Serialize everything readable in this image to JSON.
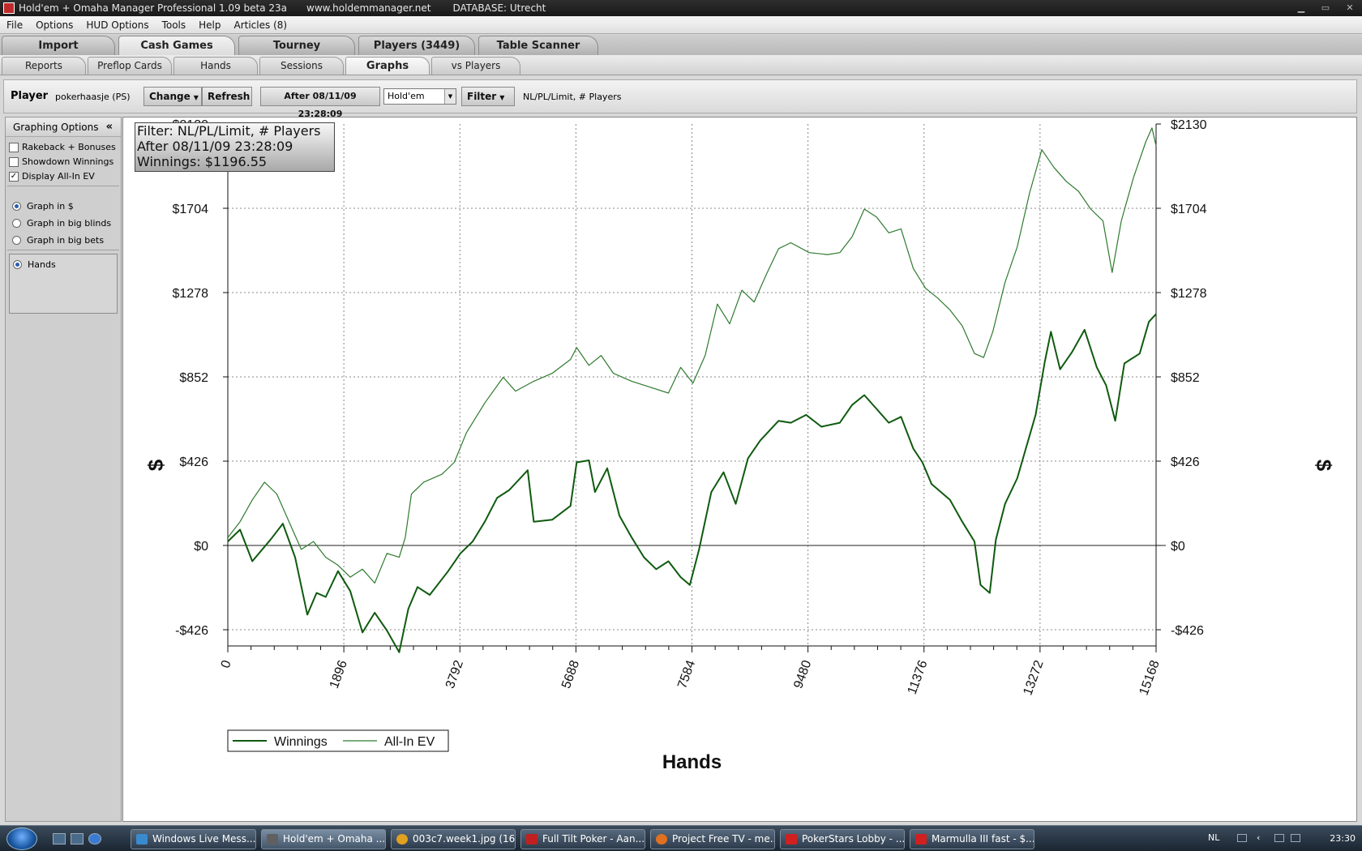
{
  "window": {
    "title": "Hold'em + Omaha Manager Professional 1.09 beta 23a",
    "website": "www.holdemmanager.net",
    "database": "DATABASE: Utrecht",
    "controls": [
      "▁",
      "▭",
      "✕"
    ]
  },
  "menu": [
    "File",
    "Options",
    "HUD Options",
    "Tools",
    "Help",
    "Articles (8)"
  ],
  "main_tabs": [
    "Import",
    "Cash Games",
    "Tourney",
    "Players (3449)",
    "Table Scanner"
  ],
  "main_tab_active": "Cash Games",
  "sub_tabs": [
    "Reports",
    "Preflop Cards",
    "Hands",
    "Sessions",
    "Graphs",
    "vs Players"
  ],
  "sub_tab_active": "Graphs",
  "toolbar": {
    "player_label": "Player",
    "player_name": "pokerhaasje (PS)",
    "change_label": "Change",
    "refresh_label": "Refresh",
    "date_filter_label": "After 08/11/09 23:28:09",
    "game_select_value": "Hold'em",
    "filter_label": "Filter",
    "filter_description": "NL/PL/Limit, # Players"
  },
  "graphing_options": {
    "header": "Graphing Options",
    "collapse_icon": "«",
    "checkboxes": [
      {
        "label": "Rakeback + Bonuses",
        "checked": false
      },
      {
        "label": "Showdown Winnings",
        "checked": false
      },
      {
        "label": "Display All-In EV",
        "checked": true
      }
    ],
    "graph_units": [
      {
        "label": "Graph in $",
        "selected": true
      },
      {
        "label": "Graph in big blinds",
        "selected": false
      },
      {
        "label": "Graph in big bets",
        "selected": false
      }
    ],
    "x_axis_options": [
      {
        "label": "Hands",
        "selected": true
      }
    ]
  },
  "info_box": {
    "filter_line": "Filter: NL/PL/Limit, # Players",
    "date_line": "After 08/11/09 23:28:09",
    "winnings_line": "Winnings: $1196.55"
  },
  "chart_data": {
    "type": "line",
    "xlabel": "Hands",
    "ylabel": "$",
    "xlim": [
      0,
      15168
    ],
    "ylim": [
      -426,
      2130
    ],
    "x_ticks": [
      "0",
      "1896",
      "3792",
      "5688",
      "7584",
      "9480",
      "11376",
      "13272",
      "15168"
    ],
    "y_ticks": [
      "-$426",
      "$0",
      "$426",
      "$852",
      "$1278",
      "$1704",
      "$2130"
    ],
    "grid": true,
    "legend_position": "bottom-left",
    "series": [
      {
        "name": "Winnings",
        "color": "#0f5a0f",
        "points": [
          [
            0,
            20
          ],
          [
            200,
            80
          ],
          [
            400,
            -80
          ],
          [
            700,
            30
          ],
          [
            900,
            110
          ],
          [
            1100,
            -60
          ],
          [
            1300,
            -350
          ],
          [
            1450,
            -240
          ],
          [
            1600,
            -260
          ],
          [
            1800,
            -130
          ],
          [
            2000,
            -230
          ],
          [
            2200,
            -440
          ],
          [
            2400,
            -340
          ],
          [
            2600,
            -430
          ],
          [
            2800,
            -540
          ],
          [
            2950,
            -320
          ],
          [
            3100,
            -210
          ],
          [
            3300,
            -250
          ],
          [
            3600,
            -130
          ],
          [
            3800,
            -40
          ],
          [
            4000,
            20
          ],
          [
            4200,
            120
          ],
          [
            4400,
            240
          ],
          [
            4600,
            280
          ],
          [
            4900,
            380
          ],
          [
            5000,
            120
          ],
          [
            5300,
            130
          ],
          [
            5600,
            200
          ],
          [
            5700,
            420
          ],
          [
            5900,
            430
          ],
          [
            6000,
            270
          ],
          [
            6200,
            390
          ],
          [
            6400,
            150
          ],
          [
            6600,
            40
          ],
          [
            6800,
            -60
          ],
          [
            7000,
            -120
          ],
          [
            7200,
            -80
          ],
          [
            7400,
            -160
          ],
          [
            7550,
            -200
          ],
          [
            7700,
            -20
          ],
          [
            7900,
            270
          ],
          [
            8100,
            370
          ],
          [
            8300,
            210
          ],
          [
            8500,
            440
          ],
          [
            8700,
            530
          ],
          [
            9000,
            630
          ],
          [
            9200,
            620
          ],
          [
            9450,
            660
          ],
          [
            9700,
            600
          ],
          [
            10000,
            620
          ],
          [
            10200,
            710
          ],
          [
            10400,
            760
          ],
          [
            10600,
            690
          ],
          [
            10800,
            620
          ],
          [
            11000,
            650
          ],
          [
            11200,
            490
          ],
          [
            11350,
            420
          ],
          [
            11500,
            310
          ],
          [
            11800,
            230
          ],
          [
            12000,
            120
          ],
          [
            12200,
            20
          ],
          [
            12300,
            -200
          ],
          [
            12450,
            -240
          ],
          [
            12550,
            30
          ],
          [
            12700,
            210
          ],
          [
            12900,
            340
          ],
          [
            13050,
            500
          ],
          [
            13200,
            660
          ],
          [
            13350,
            930
          ],
          [
            13450,
            1080
          ],
          [
            13600,
            890
          ],
          [
            13800,
            980
          ],
          [
            14000,
            1090
          ],
          [
            14200,
            900
          ],
          [
            14350,
            810
          ],
          [
            14500,
            630
          ],
          [
            14650,
            920
          ],
          [
            14900,
            970
          ],
          [
            15050,
            1130
          ],
          [
            15168,
            1170
          ]
        ]
      },
      {
        "name": "All-In EV",
        "color": "#2f7a2f",
        "points": [
          [
            0,
            40
          ],
          [
            200,
            120
          ],
          [
            400,
            230
          ],
          [
            600,
            320
          ],
          [
            800,
            260
          ],
          [
            1000,
            120
          ],
          [
            1200,
            -20
          ],
          [
            1400,
            20
          ],
          [
            1600,
            -60
          ],
          [
            1800,
            -100
          ],
          [
            2000,
            -160
          ],
          [
            2200,
            -120
          ],
          [
            2400,
            -190
          ],
          [
            2600,
            -40
          ],
          [
            2800,
            -60
          ],
          [
            2900,
            40
          ],
          [
            3000,
            260
          ],
          [
            3200,
            320
          ],
          [
            3500,
            360
          ],
          [
            3700,
            420
          ],
          [
            3900,
            570
          ],
          [
            4200,
            720
          ],
          [
            4500,
            850
          ],
          [
            4700,
            780
          ],
          [
            5000,
            830
          ],
          [
            5300,
            870
          ],
          [
            5600,
            940
          ],
          [
            5700,
            1000
          ],
          [
            5900,
            910
          ],
          [
            6100,
            960
          ],
          [
            6300,
            870
          ],
          [
            6600,
            830
          ],
          [
            6900,
            800
          ],
          [
            7200,
            770
          ],
          [
            7400,
            900
          ],
          [
            7600,
            820
          ],
          [
            7800,
            960
          ],
          [
            8000,
            1220
          ],
          [
            8200,
            1120
          ],
          [
            8400,
            1290
          ],
          [
            8600,
            1230
          ],
          [
            8800,
            1370
          ],
          [
            9000,
            1500
          ],
          [
            9200,
            1530
          ],
          [
            9500,
            1480
          ],
          [
            9800,
            1470
          ],
          [
            10000,
            1480
          ],
          [
            10200,
            1560
          ],
          [
            10400,
            1700
          ],
          [
            10600,
            1660
          ],
          [
            10800,
            1580
          ],
          [
            11000,
            1600
          ],
          [
            11200,
            1400
          ],
          [
            11400,
            1300
          ],
          [
            11600,
            1250
          ],
          [
            11800,
            1190
          ],
          [
            12000,
            1110
          ],
          [
            12200,
            970
          ],
          [
            12350,
            950
          ],
          [
            12500,
            1080
          ],
          [
            12700,
            1330
          ],
          [
            12900,
            1510
          ],
          [
            13100,
            1780
          ],
          [
            13300,
            2000
          ],
          [
            13500,
            1910
          ],
          [
            13700,
            1840
          ],
          [
            13900,
            1790
          ],
          [
            14100,
            1700
          ],
          [
            14300,
            1640
          ],
          [
            14450,
            1380
          ],
          [
            14600,
            1640
          ],
          [
            14800,
            1860
          ],
          [
            15000,
            2040
          ],
          [
            15100,
            2110
          ],
          [
            15168,
            2020
          ]
        ]
      }
    ]
  },
  "taskbar": {
    "items": [
      "Windows Live Mess...",
      "Hold'em + Omaha ...",
      "003c7.week1.jpg (16...",
      "Full Tilt Poker - Aan...",
      "Project Free TV - me...",
      "PokerStars Lobby - ...",
      "Marmulla III fast - $..."
    ],
    "active_index": 1,
    "language": "NL",
    "clock": "23:30"
  }
}
